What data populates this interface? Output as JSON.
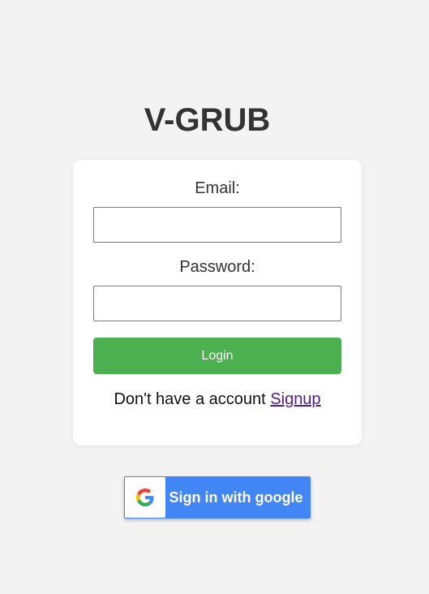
{
  "app": {
    "title": "V-GRUB"
  },
  "login_form": {
    "email_label": "Email:",
    "email_value": "",
    "email_placeholder": "",
    "password_label": "Password:",
    "password_value": "",
    "password_placeholder": "",
    "login_button_label": "Login",
    "signup_prompt": "Don't have a account ",
    "signup_link_label": "Signup"
  },
  "google_signin": {
    "label": "Sign in with google",
    "icon": "google-g-icon"
  },
  "colors": {
    "background": "#f3f3f3",
    "card": "#ffffff",
    "login_button": "#4caf50",
    "google_button": "#4285f4",
    "link_visited": "#551a8b",
    "title_text": "#333333"
  }
}
